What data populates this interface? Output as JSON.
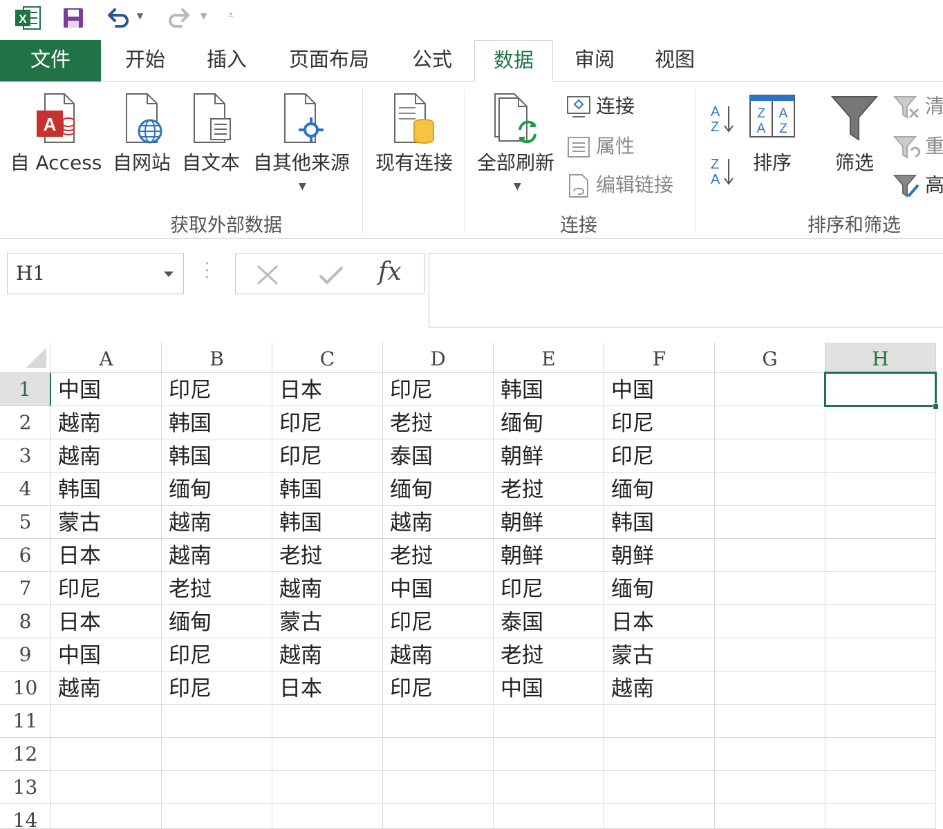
{
  "ribbon": {
    "tabs": [
      {
        "label": "文件",
        "left": 0
      },
      {
        "label": "开始"
      },
      {
        "label": "插入"
      },
      {
        "label": "页面布局"
      },
      {
        "label": "公式"
      },
      {
        "label": "数据"
      },
      {
        "label": "审阅"
      },
      {
        "label": "视图"
      }
    ],
    "active_tab": "数据",
    "external_data": {
      "group_label": "获取外部数据",
      "from_access": "自 Access",
      "from_web": "自网站",
      "from_text": "自文本",
      "from_other": "自其他来源",
      "existing": "现有连接"
    },
    "connections": {
      "group_label": "连接",
      "refresh_all": "全部刷新",
      "connections": "连接",
      "properties": "属性",
      "edit_links": "编辑链接"
    },
    "sort_filter": {
      "group_label": "排序和筛选",
      "sort": "排序",
      "filter": "筛选",
      "clear": "清",
      "reapply": "重",
      "advanced": "高"
    }
  },
  "formula_bar": {
    "name_box": "H1",
    "fx": "fx",
    "content": ""
  },
  "sheet": {
    "columns": [
      "A",
      "B",
      "C",
      "D",
      "E",
      "F",
      "G",
      "H"
    ],
    "selected_column": "H",
    "rows": [
      [
        "中国",
        "印尼",
        "日本",
        "印尼",
        "韩国",
        "中国"
      ],
      [
        "越南",
        "韩国",
        "印尼",
        "老挝",
        "缅甸",
        "印尼"
      ],
      [
        "越南",
        "韩国",
        "印尼",
        "泰国",
        "朝鲜",
        "印尼"
      ],
      [
        "韩国",
        "缅甸",
        "韩国",
        "缅甸",
        "老挝",
        "缅甸"
      ],
      [
        "蒙古",
        "越南",
        "韩国",
        "越南",
        "朝鲜",
        "韩国"
      ],
      [
        "日本",
        "越南",
        "老挝",
        "老挝",
        "朝鲜",
        "朝鲜"
      ],
      [
        "印尼",
        "老挝",
        "越南",
        "中国",
        "印尼",
        "缅甸"
      ],
      [
        "日本",
        "缅甸",
        "蒙古",
        "印尼",
        "泰国",
        "日本"
      ],
      [
        "中国",
        "印尼",
        "越南",
        "越南",
        "老挝",
        "蒙古"
      ],
      [
        "越南",
        "印尼",
        "日本",
        "印尼",
        "中国",
        "越南"
      ]
    ],
    "row_numbers": [
      "1",
      "2",
      "3",
      "4",
      "5",
      "6",
      "7",
      "8",
      "9",
      "10",
      "11",
      "12",
      "13",
      "14"
    ],
    "selected_row": "1",
    "selected_cell": "H1"
  }
}
